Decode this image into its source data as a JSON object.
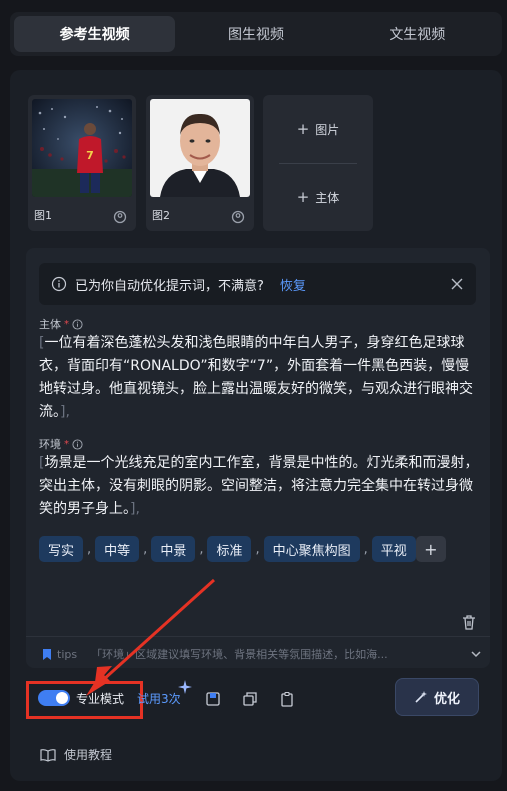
{
  "tabs": [
    {
      "label": "参考生视频",
      "active": true
    },
    {
      "label": "图生视频",
      "active": false
    },
    {
      "label": "文生视频",
      "active": false
    }
  ],
  "references": [
    {
      "label": "图1"
    },
    {
      "label": "图2"
    }
  ],
  "add_buttons": {
    "image": "+ 图片",
    "subject": "+ 主体",
    "image_text": "图片",
    "subject_text": "主体"
  },
  "notice": {
    "text": "已为你自动优化提示词，不满意?",
    "action": "恢复"
  },
  "subject_section": {
    "label": "主体",
    "required_mark": "*",
    "open_bracket": "[",
    "text": "一位有着深色蓬松头发和浅色眼睛的中年白人男子，身穿红色足球球衣，背面印有“RONALDO”和数字“7”，外面套着一件黑色西装，慢慢地转过身。他直视镜头，脸上露出温暖友好的微笑，与观众进行眼神交流。",
    "close_bracket": "],"
  },
  "environment_section": {
    "label": "环境",
    "required_mark": "*",
    "open_bracket": "[",
    "text": "场景是一个光线充足的室内工作室，背景是中性的。灯光柔和而漫射，突出主体，没有刺眼的阴影。空间整洁，将注意力完全集中在转过身微笑的男子身上。",
    "close_bracket": "],"
  },
  "tags": [
    "写实",
    "中等",
    "中景",
    "标准",
    "中心聚焦构图",
    "平视"
  ],
  "tag_separator": ",",
  "add_tag": "+",
  "tips": {
    "label": "tips",
    "text": "「环境」区域建议填写环境、背景相关等氛围描述，比如海..."
  },
  "toolbar": {
    "pro_mode_label": "专业模式",
    "pro_mode_on": true,
    "trial_text": "试用3次",
    "optimize_label": "优化"
  },
  "tutorial_label": "使用教程",
  "colors": {
    "accent": "#3f7ef2",
    "link": "#5c9bff",
    "tag_bg": "#1e3a5e",
    "annotation": "#e53224"
  }
}
